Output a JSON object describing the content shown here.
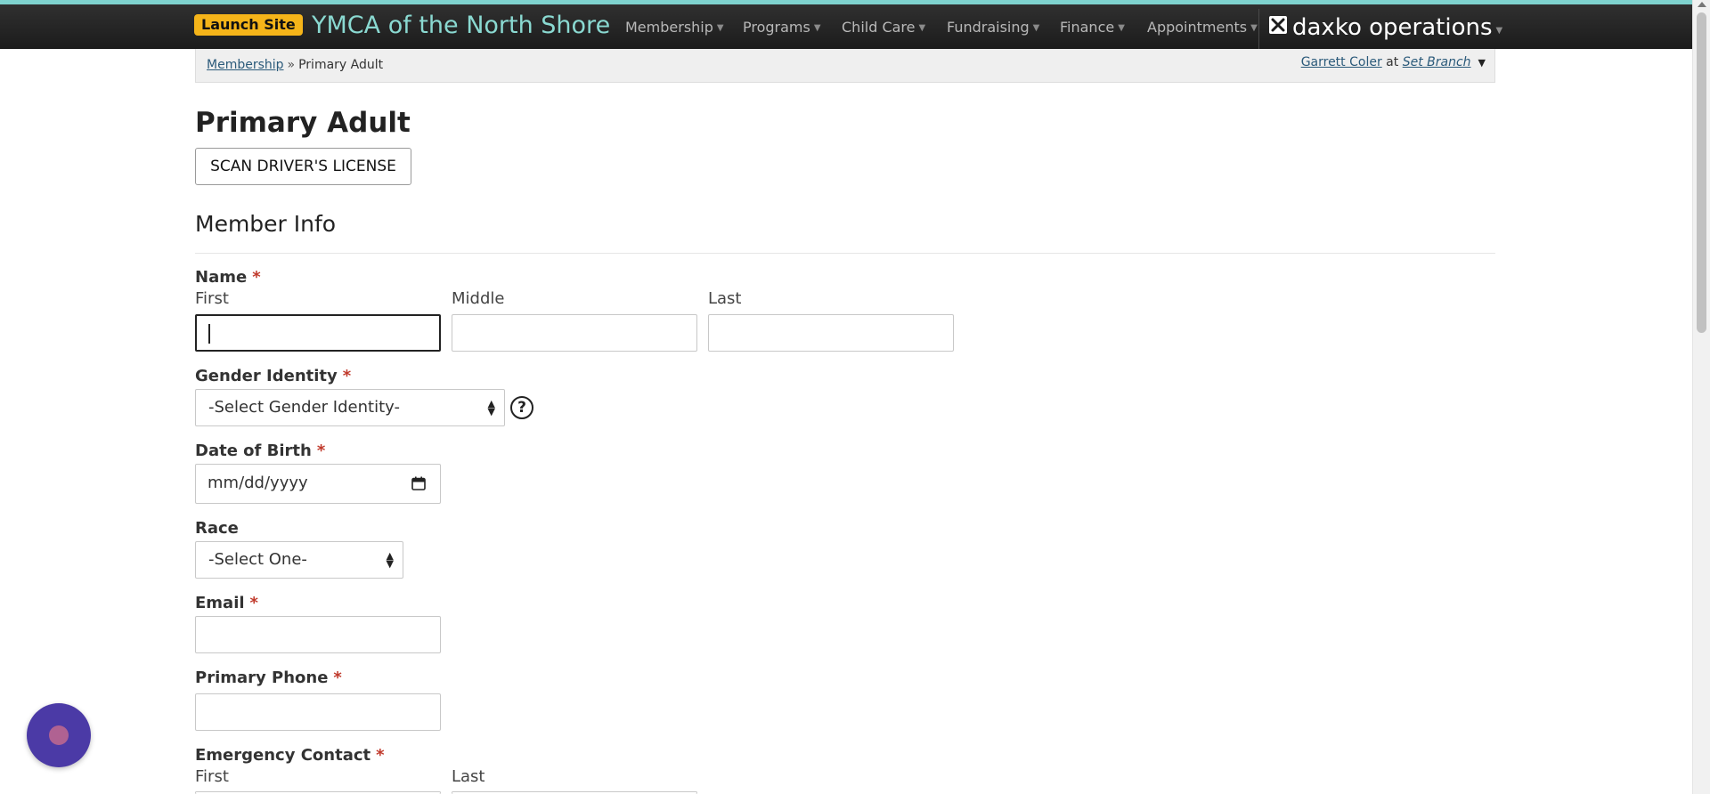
{
  "navbar": {
    "launch_label": "Launch Site",
    "org_name": "YMCA of the North Shore",
    "menus": [
      "Membership",
      "Programs",
      "Child Care",
      "Fundraising",
      "Finance",
      "Appointments"
    ],
    "product_name": "daxko operations",
    "accent_color": "#8ad9d1",
    "badge_color": "#f5b419"
  },
  "breadcrumb": {
    "parent": "Membership",
    "separator": "»",
    "current": "Primary Adult"
  },
  "user": {
    "name": "Garrett Coler",
    "at": "at",
    "branch": "Set Branch"
  },
  "page": {
    "title": "Primary Adult",
    "scan_button": "SCAN DRIVER'S LICENSE",
    "section_title": "Member Info"
  },
  "form": {
    "required_mark": "*",
    "name": {
      "label": "Name",
      "first": "First",
      "middle": "Middle",
      "last": "Last"
    },
    "gender": {
      "label": "Gender Identity",
      "selected": "-Select Gender Identity-",
      "help": "?"
    },
    "dob": {
      "label": "Date of Birth",
      "placeholder": "mm/dd/yyyy"
    },
    "race": {
      "label": "Race",
      "selected": "-Select One-"
    },
    "email": {
      "label": "Email"
    },
    "phone": {
      "label": "Primary Phone"
    },
    "emergency": {
      "label": "Emergency Contact",
      "first": "First",
      "last": "Last"
    }
  },
  "icons": {
    "chevron": "chevron-down-icon",
    "calendar": "calendar-icon",
    "help": "question-circle-icon",
    "chat": "chat-launcher-icon"
  }
}
